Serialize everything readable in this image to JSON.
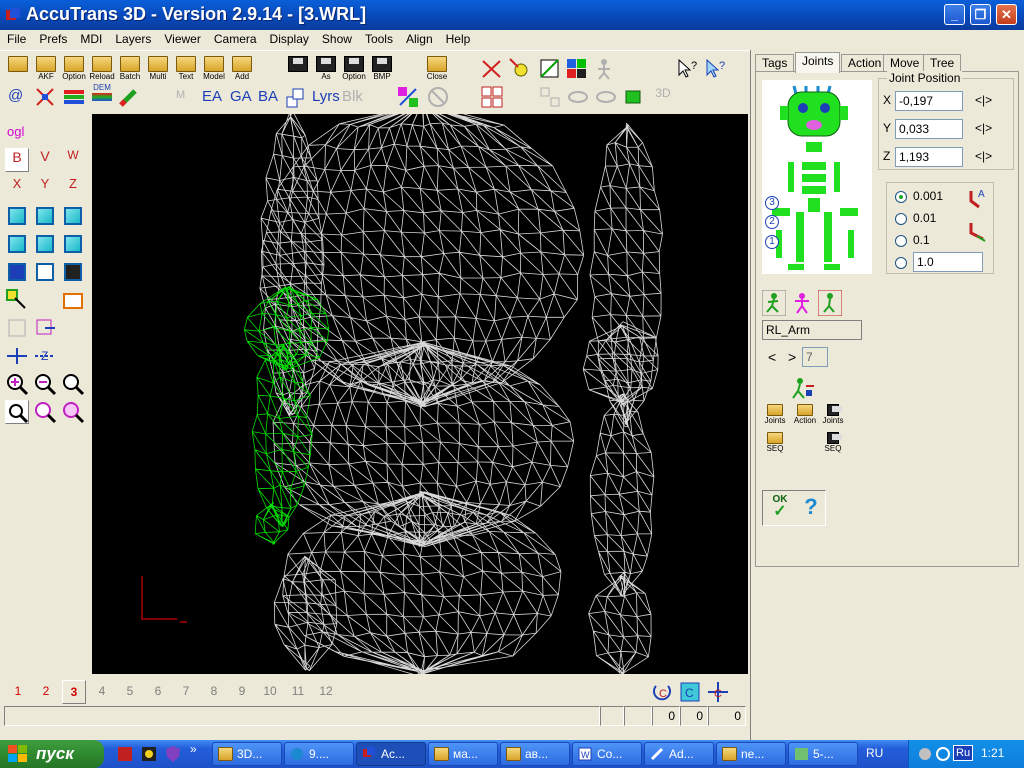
{
  "window": {
    "title": "AccuTrans 3D - Version 2.9.14 - [3.WRL]",
    "buttons": {
      "minimize": "_",
      "maximize": "❐",
      "close": "✕"
    }
  },
  "menu": [
    "File",
    "Prefs",
    "MDI",
    "Layers",
    "Viewer",
    "Camera",
    "Display",
    "Show",
    "Tools",
    "Align",
    "Help"
  ],
  "toolbar": {
    "row1": {
      "akf": "AKF",
      "option": "Option",
      "reload": "Reload",
      "batch": "Batch",
      "multi": "Multi",
      "text": "Text",
      "model": "Model",
      "add": "Add",
      "save_as": "As",
      "save_option": "Option",
      "save_bmp": "BMP",
      "close": "Close"
    },
    "row2": {
      "at": "@",
      "dem": "DEM",
      "ea": "EA",
      "ga": "GA",
      "ba": "BA",
      "lyrs": "Lyrs",
      "blks": "Blk",
      "m": "M",
      "three_d": "3D"
    }
  },
  "toolbox": {
    "ogl": "ogl",
    "rot_b": "B",
    "rot_v": "V",
    "rot_w": "W",
    "rot_x": "X",
    "rot_y": "Y",
    "rot_z": "Z"
  },
  "view_tabs": [
    "1",
    "2",
    "3",
    "4",
    "5",
    "6",
    "7",
    "8",
    "9",
    "10",
    "11",
    "12"
  ],
  "active_view": "3",
  "status": {
    "v1": "0",
    "v2": "0",
    "v3": "0"
  },
  "right_panel": {
    "tabs": [
      "Tags",
      "Joints",
      "Action",
      "Move",
      "Tree"
    ],
    "active_tab": "Joints",
    "joint_position": {
      "label": "Joint Position",
      "x_label": "X",
      "x": "-0,197",
      "y_label": "Y",
      "y": "0,033",
      "z_label": "Z",
      "z": "1,193",
      "spin": "<|>"
    },
    "step_options": [
      "0.001",
      "0.01",
      "0.1"
    ],
    "step_custom": "1.0",
    "step_selected": "0.001",
    "level_numbers": [
      "3",
      "2",
      "1"
    ],
    "joint_name": "RL_Arm",
    "nav_prev": "<",
    "nav_next": ">",
    "joint_index": "7",
    "buttons": {
      "joints_open": "Joints",
      "action_open": "Action",
      "joints_save": "Joints",
      "seq_open": "SEQ",
      "seq_save": "SEQ",
      "ok": "OK",
      "help": "?"
    }
  },
  "taskbar": {
    "start": "пуск",
    "items": [
      "3D...",
      "9....",
      "Ac...",
      "ма...",
      "ав...",
      "Co...",
      "Ad...",
      "ne...",
      "5-..."
    ],
    "active_item": "Ac...",
    "lang": "RU",
    "tray_lang": "Ru",
    "clock": "1:21"
  },
  "colors": {
    "selected_mesh": "#00e000",
    "mesh": "#d8d8d8",
    "viewport_bg": "#000000",
    "axis": "#d00000"
  }
}
